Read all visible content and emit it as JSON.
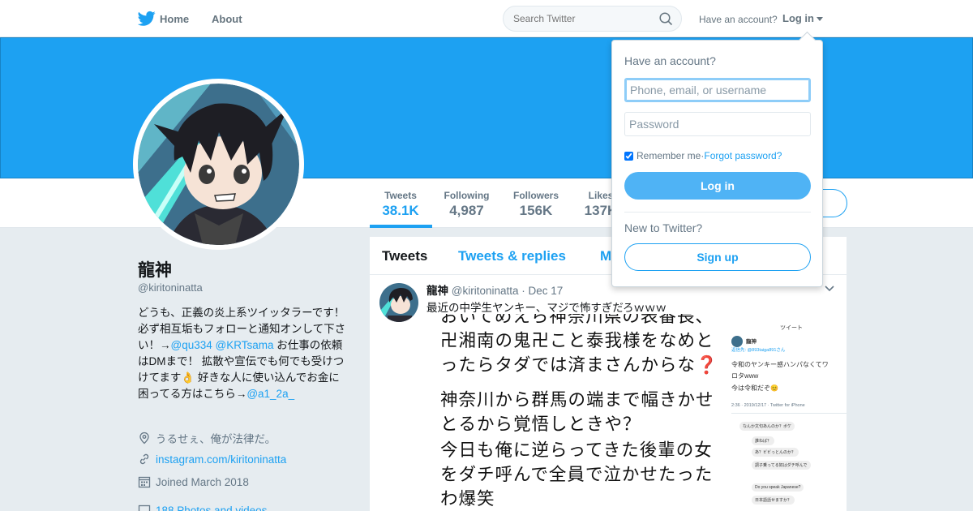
{
  "brand_color": "#1da1f2",
  "topbar": {
    "logo_icon": "twitter-bird-icon",
    "home_label": "Home",
    "about_label": "About",
    "search_placeholder": "Search Twitter",
    "have_account": "Have an account?",
    "login_label": "Log in"
  },
  "profile": {
    "name": "龍神",
    "handle": "@kiritoninatta",
    "bio_text_1": "どうも、正義の炎上系ツイッタラーです！ 必ず相互垢もフォローと通知オンして下さい！→",
    "bio_link_1": "@qu334",
    "bio_link_2": "@KRTsama",
    "bio_text_2": " お仕事の依頼はDMまで！ 拡散や宣伝でも何でも受けつけてます",
    "bio_emoji": "👌",
    "bio_text_3": " 好きな人に使い込んでお金に困ってる方はこちら→",
    "bio_link_3": "@a1_2a_",
    "location": "うるせぇ、俺が法律だ。",
    "website": "instagram.com/kiritoninatta",
    "joined": "Joined March 2018",
    "photos": "188 Photos and videos"
  },
  "stats": [
    {
      "label": "Tweets",
      "value": "38.1K"
    },
    {
      "label": "Following",
      "value": "4,987"
    },
    {
      "label": "Followers",
      "value": "156K"
    },
    {
      "label": "Likes",
      "value": "137K"
    }
  ],
  "timeline": {
    "tabs": [
      "Tweets",
      "Tweets & replies",
      "Media"
    ],
    "tweet": {
      "name": "龍神",
      "handle": "@kiritoninatta",
      "date": "· Dec 17",
      "text": "最近の中学生ヤンキー、マジで怖すぎだろｗｗｗ",
      "image_lines": [
        "卍湘南の鬼卍こと泰我様をなめと",
        "ったらタダでは済まさんからな❓",
        "神奈川から群馬の端まで幅きかせ",
        "とるから覚悟しときや？",
        "今日も俺に逆らってきた後輩の女",
        "をダチ呼んで全員で泣かせたった",
        "わ爆笑"
      ],
      "mini": {
        "header": "ツイート",
        "name": "龍神",
        "reply": "返信先: @893taiga891さん",
        "line1": "令和のヤンキー感ハンパなくてワ",
        "line2": "ロタwww",
        "line3": "今は令和だぞ😊",
        "time": "2:36 · 2019/12/17 · Twitter for iPhone",
        "chats": [
          "なんか文句あんのか？ボケ",
          "誰ねば？",
          "あ？ビビっとんのか？",
          "調子乗ってる奴はダチ呼んで",
          "Do you speak Japanese?",
          "日本語話せますか？"
        ]
      }
    }
  },
  "login_dropdown": {
    "title": "Have an account?",
    "username_placeholder": "Phone, email, or username",
    "password_placeholder": "Password",
    "remember": "Remember me",
    "separator": " · ",
    "forgot": "Forgot password?",
    "login_button": "Log in",
    "new_to": "New to Twitter?",
    "signup_button": "Sign up"
  }
}
